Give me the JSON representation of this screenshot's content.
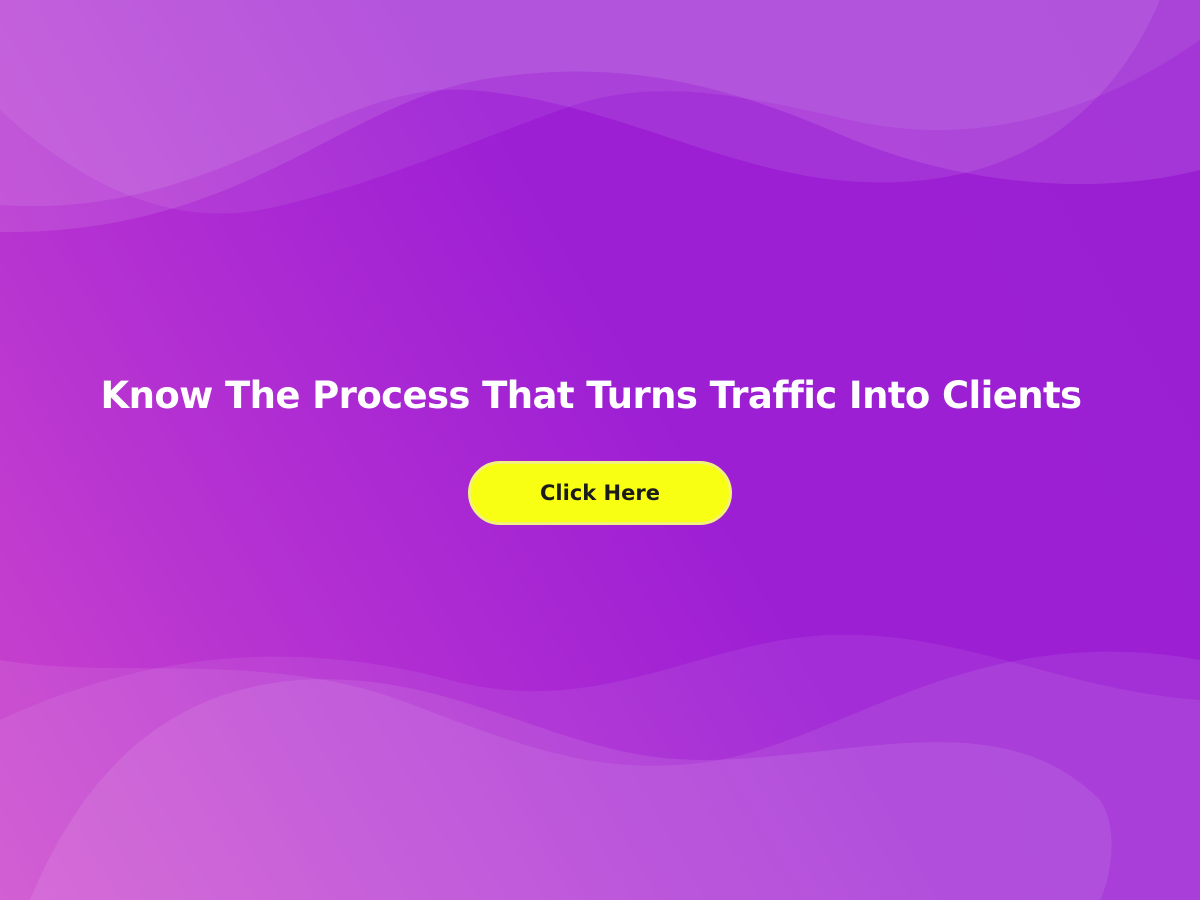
{
  "hero": {
    "headline": "Know The Process That Turns Traffic Into Clients",
    "cta_label": "Click Here"
  },
  "colors": {
    "background_start": "#cc45cc",
    "background_end": "#9a1fd2",
    "cta_fill": "#f8ff12",
    "cta_border": "#f2f27a",
    "headline_text": "#ffffff",
    "cta_text": "#1b1b1b"
  }
}
